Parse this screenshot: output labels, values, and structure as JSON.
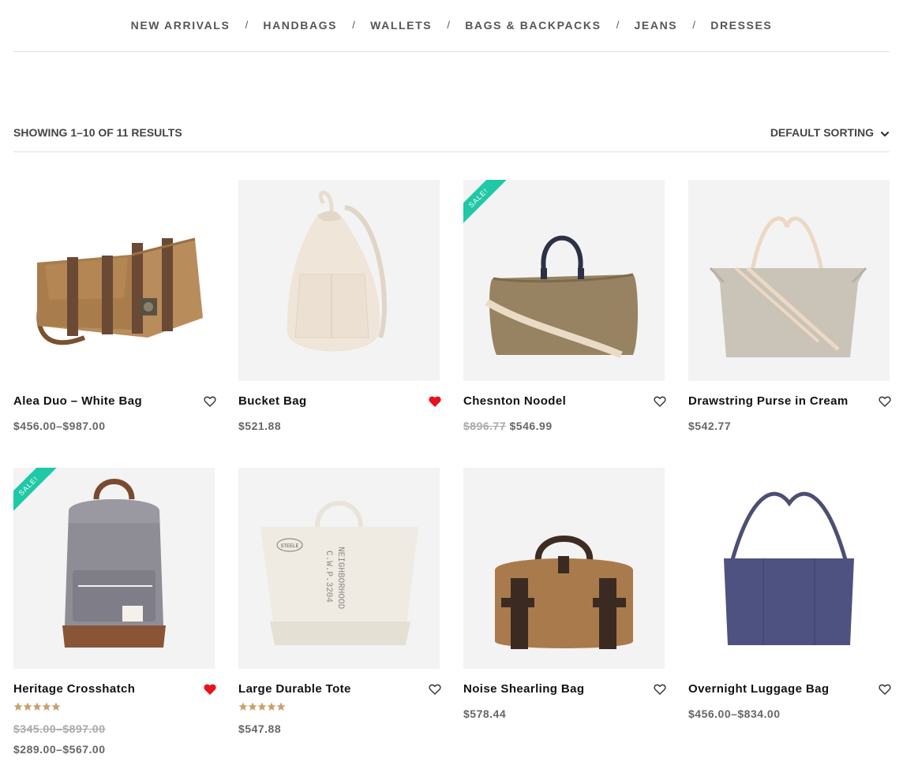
{
  "nav": {
    "items": [
      "NEW ARRIVALS",
      "HANDBAGS",
      "WALLETS",
      "BAGS & BACKPACKS",
      "JEANS",
      "DRESSES"
    ],
    "separator": "/"
  },
  "toolbar": {
    "result_count": "SHOWING 1–10 OF 11 RESULTS",
    "sorting_label": "DEFAULT SORTING",
    "sorting_icon": "chevron-down-icon"
  },
  "products": [
    {
      "name": "Alea Duo – White Bag",
      "price": "$456.00–$987.00",
      "sale": false,
      "wishlisted": false,
      "rating": 0
    },
    {
      "name": "Bucket Bag",
      "price": "$521.88",
      "sale": false,
      "wishlisted": true,
      "rating": 0
    },
    {
      "name": "Chesnton Noodel",
      "old_price": "$896.77",
      "price": "$546.99",
      "sale": true,
      "sale_label": "SALE!",
      "wishlisted": false,
      "rating": 0
    },
    {
      "name": "Drawstring Purse in Cream",
      "price": "$542.77",
      "sale": false,
      "wishlisted": false,
      "rating": 0
    },
    {
      "name": "Heritage Crosshatch",
      "old_price": "$345.00–$897.00",
      "price": "$289.00–$567.00",
      "sale": true,
      "sale_label": "SALE!",
      "wishlisted": true,
      "rating": 5
    },
    {
      "name": "Large Durable Tote",
      "price": "$547.88",
      "sale": false,
      "wishlisted": false,
      "rating": 5
    },
    {
      "name": "Noise Shearling Bag",
      "price": "$578.44",
      "sale": false,
      "wishlisted": false,
      "rating": 0
    },
    {
      "name": "Overnight Luggage Bag",
      "price": "$456.00–$834.00",
      "sale": false,
      "wishlisted": false,
      "rating": 0
    }
  ],
  "colors": {
    "sale_ribbon": "#1fc8a6",
    "wishlist_active": "#e8131b",
    "star": "#c9a06b",
    "price": "#666666",
    "old_price": "#aaaaaa"
  },
  "icons": {
    "wishlist": "heart-icon",
    "rating": "star-icon"
  },
  "images": [
    "canvas-messenger-bag",
    "cream-bucket-bag",
    "olive-weekender-bag",
    "grey-linen-tote",
    "grey-backpack",
    "canvas-tote-neighborhood",
    "tan-duffel-bag",
    "navy-tote-bag"
  ],
  "image_text": {
    "tote_print_1": "NEIGHBORHOOD",
    "tote_print_2": "C.W.P.3204",
    "tote_badge": "STEELE"
  }
}
